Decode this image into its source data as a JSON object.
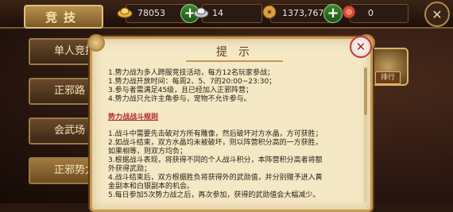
{
  "header": {
    "title": "竞技",
    "resources": [
      {
        "name": "gold-ingot",
        "value": "78053",
        "color": "#e8b23a"
      },
      {
        "name": "silver-ingot",
        "value": "14",
        "color": "#c8c8d0"
      },
      {
        "name": "coin",
        "value": "1373,767",
        "color": "#d8a040"
      },
      {
        "name": "token",
        "value": "0",
        "color": "#d04a3a"
      }
    ]
  },
  "tabs": [
    {
      "label": "单人竞技",
      "active": false
    },
    {
      "label": "正邪路",
      "active": false
    },
    {
      "label": "会武场",
      "active": false
    },
    {
      "label": "正邪势力战",
      "active": true
    }
  ],
  "side": {
    "rank_label": "排行"
  },
  "dialog": {
    "title": "提示",
    "rules_intro": [
      "1.势力战为多人跨服竞技活动，每方12名玩家参战；",
      "1.势力战开放时间：每周2、5、7的20:00~23:30；",
      "3.参与者需满足45级，且已经加入正邪阵营；",
      "4.势力战只允许主角参与，宠物不允许参与。"
    ],
    "section_title": "势力战战斗规则",
    "rules_battle": [
      "1.战斗中需要先击破对方所有雕像，然后破坏对方水晶，方可获胜；",
      "2.如战斗结束，双方水晶均未被破坏，则以阵营积分高的一方获胜，",
      "如果相等，则双方均负；",
      "3.根据战斗表现，将获得不同的个人战斗积分，本阵营积分高者将额",
      "外获得武勋；",
      "4.战斗结束后，双方根据胜负将获得外的武勋值，并分别赠予进入黄",
      "金副本和白银副本的机会。",
      "5.每日参加5次势力战之后，再次参加，获得的武勋值会大幅减少。"
    ]
  }
}
